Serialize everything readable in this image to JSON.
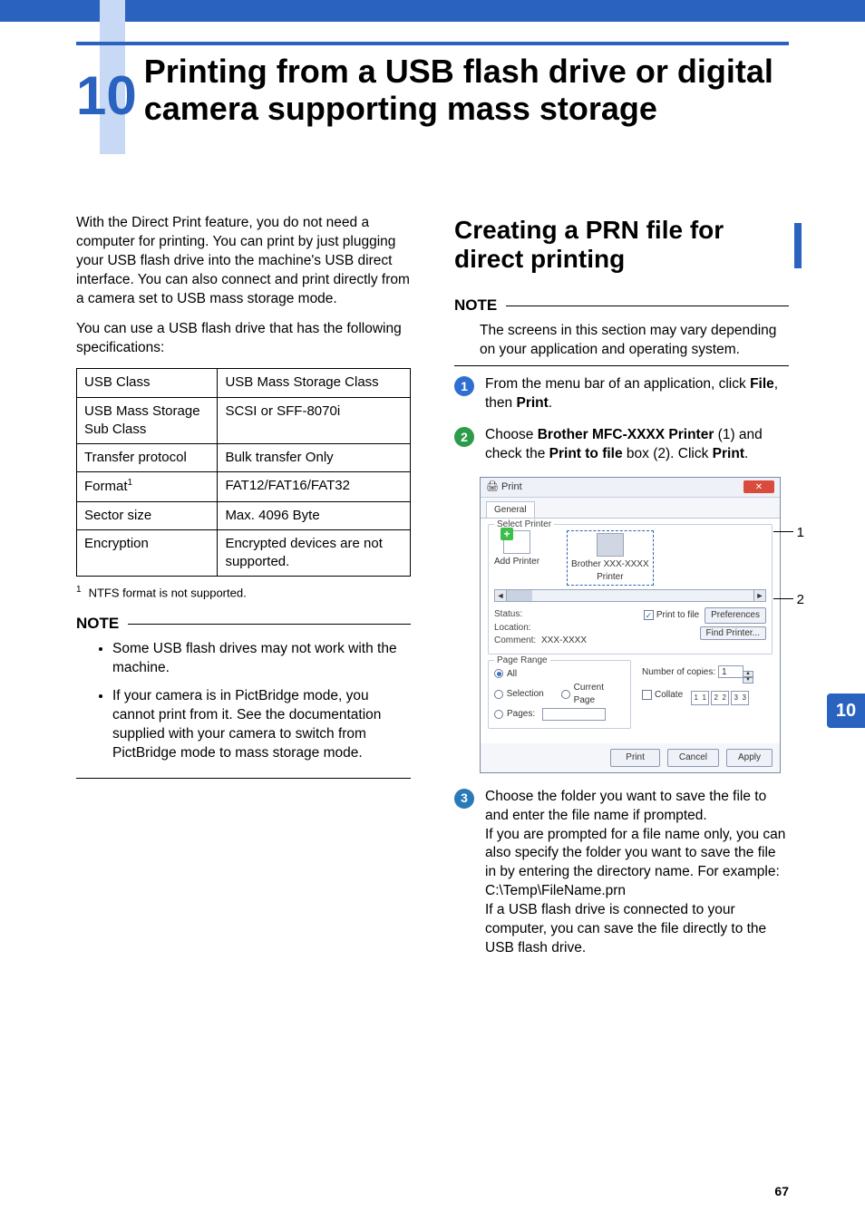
{
  "chapter": {
    "number": "10",
    "title": "Printing from a USB flash drive or digital camera supporting mass storage"
  },
  "left": {
    "intro1": "With the Direct Print feature, you do not need a computer for printing. You can print by just plugging your USB flash drive into the machine's USB direct interface. You can also connect and print directly from a camera set to USB mass storage mode.",
    "intro2": "You can use a USB flash drive that has the following specifications:",
    "table": [
      {
        "k": "USB Class",
        "v": "USB Mass Storage Class"
      },
      {
        "k": "USB Mass Storage Sub Class",
        "v": "SCSI or SFF-8070i"
      },
      {
        "k": "Transfer protocol",
        "v": "Bulk transfer Only"
      },
      {
        "k_html": "Format",
        "sup": "1",
        "v": "FAT12/FAT16/FAT32"
      },
      {
        "k": "Sector size",
        "v": "Max. 4096 Byte"
      },
      {
        "k": "Encryption",
        "v": "Encrypted devices are not supported."
      }
    ],
    "footnote": {
      "num": "1",
      "text": "NTFS format is not supported."
    },
    "note_label": "NOTE",
    "note_bullets": [
      "Some USB flash drives may not work with the machine.",
      "If your camera is in PictBridge mode, you cannot print from it. See the documentation supplied with your camera to switch from PictBridge mode to mass storage mode."
    ]
  },
  "right": {
    "section_title": "Creating a PRN file for direct printing",
    "note_label": "NOTE",
    "note_text": "The screens in this section may vary depending on your application and operating system.",
    "step1_a": "From the menu bar of an application, click ",
    "step1_b": "File",
    "step1_c": ", then ",
    "step1_d": "Print",
    "step1_e": ".",
    "step2_a": "Choose ",
    "step2_b": "Brother MFC-XXXX Printer",
    "step2_c": " (1) and check the ",
    "step2_d": "Print to file",
    "step2_e": " box (2). Click ",
    "step2_f": "Print",
    "step2_g": ".",
    "step3": "Choose the folder you want to save the file to and enter the file name if prompted.\nIf you are prompted for a file name only, you can also specify the folder you want to save the file in by entering the directory name. For example:\nC:\\Temp\\FileName.prn\nIf a USB flash drive is connected to your computer, you can save the file directly to the USB flash drive.",
    "callout1": "1",
    "callout2": "2"
  },
  "dialog": {
    "title": "Print",
    "tab": "General",
    "group_select": "Select Printer",
    "add_printer": "Add Printer",
    "brother_line1": "Brother XXX-XXXX",
    "brother_line2": "Printer",
    "status": "Status:",
    "location": "Location:",
    "comment": "Comment:",
    "comment_val": "XXX-XXXX",
    "print_to_file": "Print to file",
    "preferences": "Preferences",
    "find_printer": "Find Printer...",
    "group_range": "Page Range",
    "all": "All",
    "selection": "Selection",
    "current_page": "Current Page",
    "pages": "Pages:",
    "num_copies": "Number of copies:",
    "copies_val": "1",
    "collate": "Collate",
    "btn_print": "Print",
    "btn_cancel": "Cancel",
    "btn_apply": "Apply"
  },
  "side_tab": "10",
  "page_number": "67"
}
